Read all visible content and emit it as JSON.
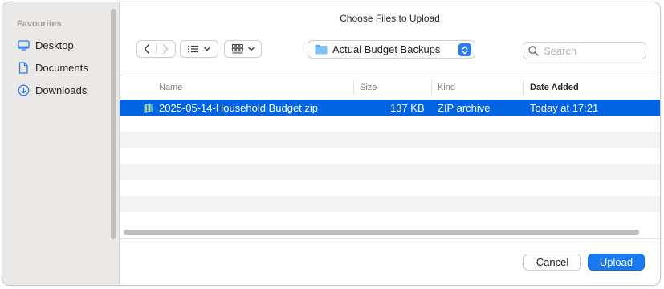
{
  "dialog": {
    "title": "Choose Files to Upload"
  },
  "sidebar": {
    "header": "Favourites",
    "items": [
      {
        "label": "Desktop",
        "icon": "desktop-icon"
      },
      {
        "label": "Documents",
        "icon": "document-icon"
      },
      {
        "label": "Downloads",
        "icon": "download-icon"
      }
    ]
  },
  "toolbar": {
    "location": "Actual Budget Backups",
    "search_placeholder": "Search",
    "accent_color": "#2b7cf0"
  },
  "columns": {
    "name": "Name",
    "size": "Size",
    "kind": "Kind",
    "date_added": "Date Added"
  },
  "files": [
    {
      "name": "2025-05-14-Household Budget.zip",
      "size": "137 KB",
      "kind": "ZIP archive",
      "date_added": "Today at 17:21",
      "selected": true,
      "icon": "zip-archive-icon"
    }
  ],
  "buttons": {
    "cancel": "Cancel",
    "upload": "Upload"
  },
  "colors": {
    "selection": "#0063e1",
    "primary_button": "#1a78f2"
  }
}
